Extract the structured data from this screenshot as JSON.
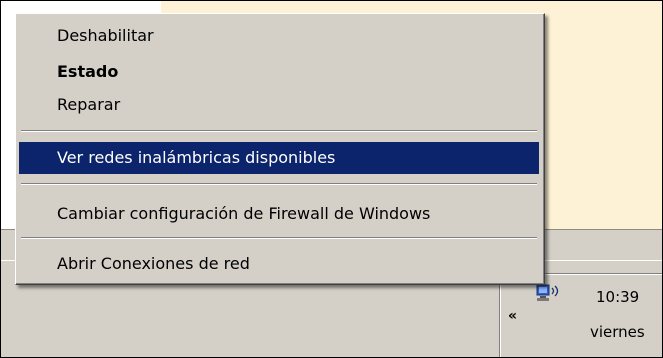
{
  "context_menu": {
    "items": [
      {
        "label": "Deshabilitar"
      },
      {
        "label": "Estado"
      },
      {
        "label": "Reparar"
      },
      {
        "label": "Ver redes inalámbricas disponibles"
      },
      {
        "label": "Cambiar configuración de Firewall de Windows"
      },
      {
        "label": "Abrir Conexiones de red"
      }
    ],
    "highlight_color": "#0b246b",
    "background_color": "#d4d0c8"
  },
  "taskbar": {
    "tray_expand_label": "«",
    "network_icon": "wireless-network-icon",
    "clock": {
      "time": "10:39",
      "day": "viernes"
    }
  },
  "background_window": {
    "color": "#fdf2d6"
  }
}
